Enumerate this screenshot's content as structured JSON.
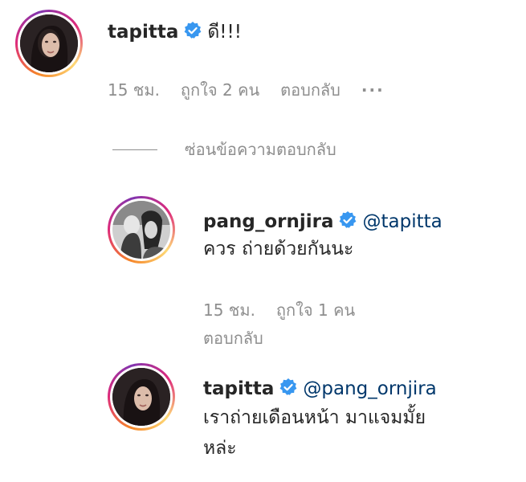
{
  "comments": [
    {
      "username": "tapitta",
      "text": "ดี!!!",
      "time": "15 ชม.",
      "likes": "ถูกใจ 2 คน",
      "reply": "ตอบกลับ",
      "more": "···"
    }
  ],
  "hide_replies": "ซ่อนข้อความตอบกลับ",
  "replies": [
    {
      "username": "pang_ornjira",
      "mention": "@tapitta",
      "text": "ควร ถ่ายด้วยกันนะ",
      "time": "15 ชม.",
      "likes": "ถูกใจ 1 คน",
      "reply": "ตอบกลับ"
    },
    {
      "username": "tapitta",
      "mention": "@pang_ornjira",
      "text_line1": "เราถ่ายเดือนหน้า มาแจมมั้ย",
      "text_line2": "หล่ะ"
    }
  ],
  "colors": {
    "verified": "#3897f0",
    "mention": "#00376b",
    "meta": "#8e8e8e"
  }
}
